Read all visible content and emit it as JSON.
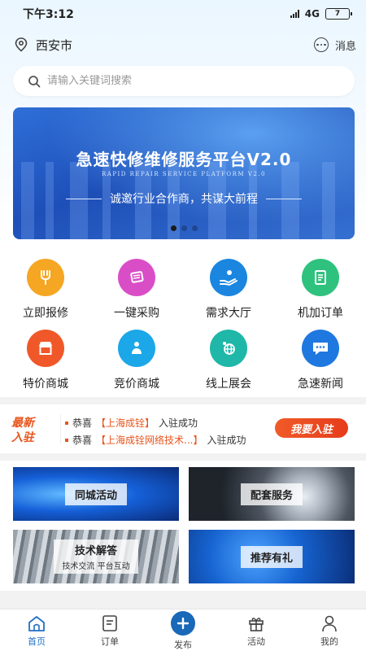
{
  "status_bar": {
    "time": "下午3:12",
    "network": "4G",
    "battery": "7"
  },
  "location": {
    "city": "西安市",
    "message_label": "消息"
  },
  "search": {
    "placeholder": "请输入关键词搜索"
  },
  "banner": {
    "title": "急速快修维修服务平台V2.0",
    "subtitle": "RAPID REPAIR SERVICE PLATFORM V2.0",
    "slogan": "诚邀行业合作商，共谋大前程",
    "indicator_count": 3,
    "active_indicator": 1
  },
  "menu": [
    {
      "label": "立即报修",
      "icon": "repair-icon",
      "color": "#f5a623"
    },
    {
      "label": "一键采购",
      "icon": "purchase-cart-icon",
      "color": "#d94ec7"
    },
    {
      "label": "需求大厅",
      "icon": "demand-hand-icon",
      "color": "#1a86e0"
    },
    {
      "label": "机加订单",
      "icon": "order-document-icon",
      "color": "#2ec27e"
    },
    {
      "label": "特价商城",
      "icon": "store-icon",
      "color": "#f0582a"
    },
    {
      "label": "竞价商城",
      "icon": "bidding-people-icon",
      "color": "#1ba7e8"
    },
    {
      "label": "线上展会",
      "icon": "globe-icon",
      "color": "#1fb7a8"
    },
    {
      "label": "急速新闻",
      "icon": "chat-bubble-icon",
      "color": "#1f78e0"
    }
  ],
  "news": {
    "badge_line1": "最新",
    "badge_line2": "入驻",
    "items": [
      {
        "prefix": "恭喜",
        "company": "【上海成铨】",
        "suffix": "入驻成功"
      },
      {
        "prefix": "恭喜",
        "company": "【上海成铨网络技术...】",
        "suffix": "入驻成功"
      }
    ],
    "join_button": "我要入驻"
  },
  "cards": [
    {
      "label": "同城活动"
    },
    {
      "label": "配套服务"
    },
    {
      "label": "技术解答",
      "sub": "技术交流   平台互动"
    },
    {
      "label": "推荐有礼"
    }
  ],
  "tabs": [
    {
      "label": "首页",
      "icon": "home-icon",
      "active": true
    },
    {
      "label": "订单",
      "icon": "order-icon",
      "active": false
    },
    {
      "label": "发布",
      "icon": "plus-circle-icon",
      "active": false
    },
    {
      "label": "活动",
      "icon": "gift-icon",
      "active": false
    },
    {
      "label": "我的",
      "icon": "person-icon",
      "active": false
    }
  ],
  "colors": {
    "accent": "#1f6fc8",
    "news_orange": "#e8541c"
  }
}
